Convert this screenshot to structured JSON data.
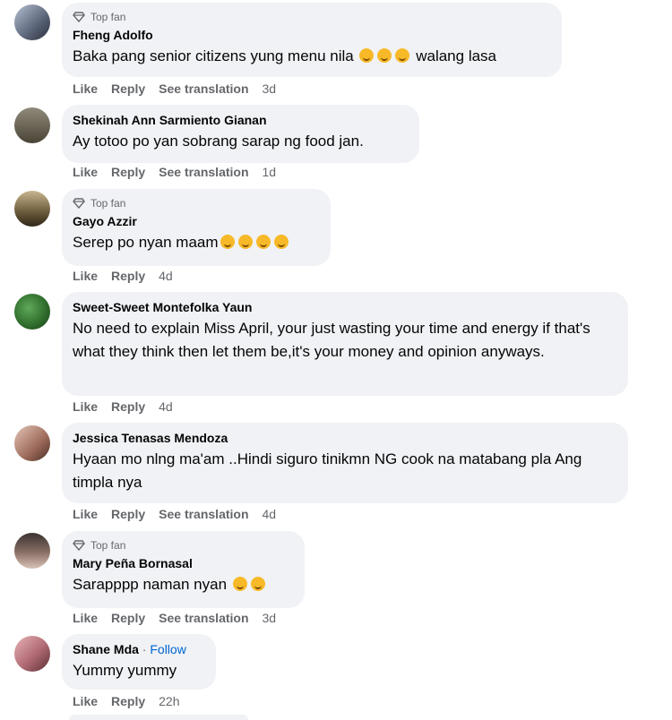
{
  "badge_label": "Top fan",
  "actions": {
    "like": "Like",
    "reply": "Reply",
    "translate": "See translation"
  },
  "comments": [
    {
      "author": "Fheng Adolfo",
      "top_fan": true,
      "text": "Baka pang senior citizens yung menu nila",
      "emoji": "🤣🤣🤣",
      "text_after": "walang lasa",
      "time": "3d",
      "translate": true
    },
    {
      "author": "Shekinah Ann Sarmiento Gianan",
      "top_fan": false,
      "text": "Ay totoo po yan sobrang sarap ng food jan.",
      "time": "1d",
      "translate": true
    },
    {
      "author": "Gayo Azzir",
      "top_fan": true,
      "text": "Serep po nyan maam",
      "emoji": "😜😜😜😜",
      "time": "4d",
      "translate": false
    },
    {
      "author": "Sweet-Sweet Montefolka Yaun",
      "top_fan": false,
      "text": "No need to explain Miss April, your just wasting your time and energy if that's what they think then let them be,it's your money and opinion anyways.",
      "time": "4d",
      "translate": false
    },
    {
      "author": "Jessica Tenasas Mendoza",
      "top_fan": false,
      "text": "Hyaan mo nlng ma'am ..Hindi siguro tinikmn NG cook na matabang pla Ang timpla nya",
      "time": "4d",
      "translate": true
    },
    {
      "author": "Mary Peña Bornasal",
      "top_fan": true,
      "text": "Sarapppp naman nyan",
      "emoji": "😊😊",
      "time": "3d",
      "translate": true
    },
    {
      "author": "Shane Mda",
      "follow": "Follow",
      "top_fan": false,
      "text": "Yummy yummy",
      "time": "22h",
      "translate": false
    }
  ]
}
